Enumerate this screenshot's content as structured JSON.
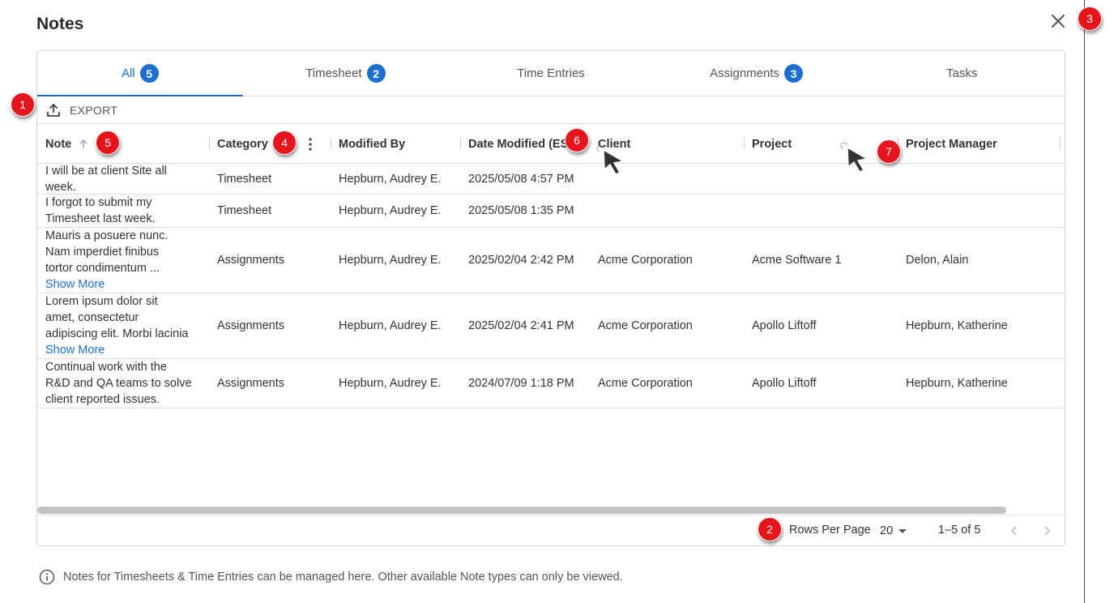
{
  "dialog": {
    "title": "Notes"
  },
  "tabs": [
    {
      "label": "All",
      "count": "5",
      "active": true
    },
    {
      "label": "Timesheet",
      "count": "2",
      "active": false
    },
    {
      "label": "Time Entries",
      "count": "",
      "active": false
    },
    {
      "label": "Assignments",
      "count": "3",
      "active": false
    },
    {
      "label": "Tasks",
      "count": "",
      "active": false
    }
  ],
  "toolbar": {
    "export_label": "EXPORT",
    "export_icon": "upload-icon"
  },
  "columns": {
    "note": "Note",
    "category": "Category",
    "modified_by": "Modified By",
    "date_modified": "Date Modified (EST)",
    "client": "Client",
    "project": "Project",
    "project_manager": "Project Manager"
  },
  "rows": [
    {
      "note_lines": [
        "I will be at client Site all",
        "week."
      ],
      "show_more": "",
      "category": "Timesheet",
      "modified_by": "Hepburn, Audrey E.",
      "date_modified": "2025/05/08 4:57 PM",
      "client": "",
      "project": "",
      "project_manager": ""
    },
    {
      "note_lines": [
        "I forgot to submit my",
        "Timesheet last week."
      ],
      "show_more": "",
      "category": "Timesheet",
      "modified_by": "Hepburn, Audrey E.",
      "date_modified": "2025/05/08 1:35 PM",
      "client": "",
      "project": "",
      "project_manager": ""
    },
    {
      "note_lines": [
        "Mauris a posuere nunc.",
        "Nam imperdiet finibus",
        "tortor condimentum ..."
      ],
      "show_more": "Show More",
      "category": "Assignments",
      "modified_by": "Hepburn, Audrey E.",
      "date_modified": "2025/02/04 2:42 PM",
      "client": "Acme Corporation",
      "project": "Acme Software 1",
      "project_manager": "Delon, Alain"
    },
    {
      "note_lines": [
        "Lorem ipsum dolor sit",
        "amet, consectetur",
        "adipiscing elit. Morbi lacinia"
      ],
      "show_more": "Show More",
      "category": "Assignments",
      "modified_by": "Hepburn, Audrey E.",
      "date_modified": "2025/02/04 2:41 PM",
      "client": "Acme Corporation",
      "project": "Apollo Liftoff",
      "project_manager": "Hepburn, Katherine"
    },
    {
      "note_lines": [
        "Continual work with the",
        "R&D and QA teams to solve",
        "client reported issues."
      ],
      "show_more": "",
      "category": "Assignments",
      "modified_by": "Hepburn, Audrey E.",
      "date_modified": "2024/07/09 1:18 PM",
      "client": "Acme Corporation",
      "project": "Apollo Liftoff",
      "project_manager": "Hepburn, Katherine"
    }
  ],
  "pagination": {
    "rows_per_page_label": "Rows Per Page",
    "rows_per_page_value": "20",
    "range": "1–5 of 5"
  },
  "info": {
    "text": "Notes for Timesheets & Time Entries can be managed here. Other available Note types can only be viewed.",
    "icon": "info-icon"
  },
  "callouts": [
    "1",
    "2",
    "3",
    "4",
    "5",
    "6",
    "7"
  ],
  "colors": {
    "accent": "#1c6fd1",
    "callout": "#e8141c"
  }
}
